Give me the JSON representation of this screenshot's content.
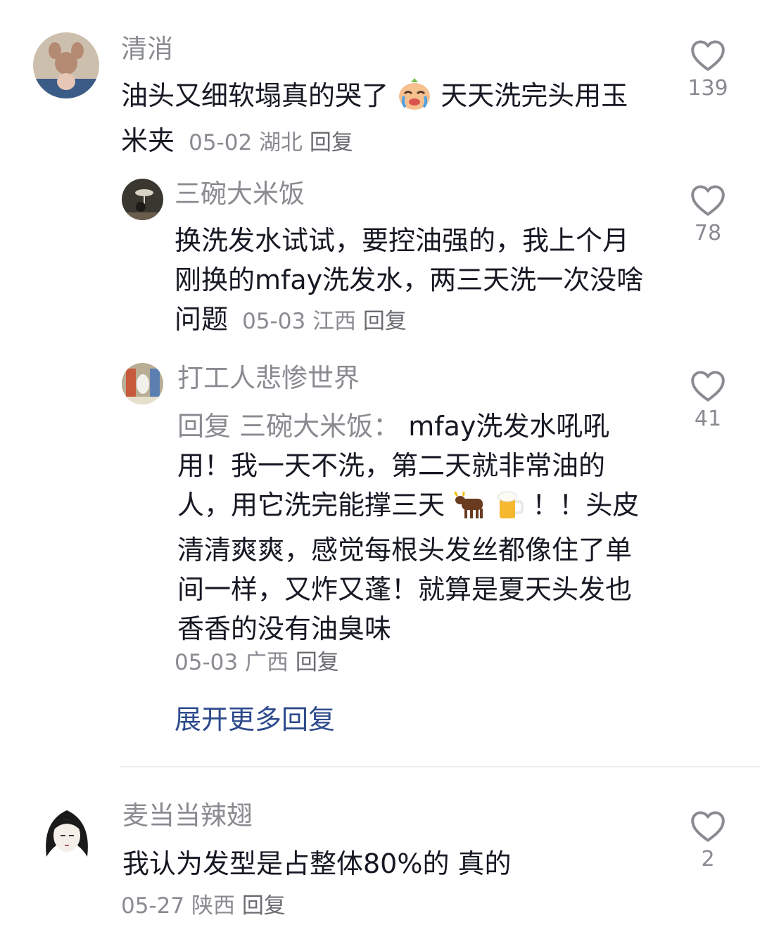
{
  "comments": [
    {
      "username": "清消",
      "text": "油头又细软塌真的哭了",
      "emoji": "crying-face-icon",
      "text_after": "天天洗完头用玉米夹",
      "date": "05-02",
      "location": "湖北",
      "reply_label": "回复",
      "likes": "139"
    },
    {
      "username": "三碗大米饭",
      "text": "换洗发水试试，要控油强的，我上个月刚换的mfay洗发水，两三天洗一次没啥问题",
      "date": "05-03",
      "location": "江西",
      "reply_label": "回复",
      "likes": "78"
    },
    {
      "username": "打工人悲惨世界",
      "reply_prefix": "回复",
      "reply_to": "三碗大米饭：",
      "text": "mfay洗发水吼吼用！我一天不洗，第二天就非常油的人，用它洗完能撑三天",
      "emojis": [
        "ox-icon",
        "beer-mug-icon"
      ],
      "text_after": "！！头皮清清爽爽，感觉每根头发丝都像住了单间一样，又炸又蓬！就算是夏天头发也香香的没有油臭味",
      "date": "05-03",
      "location": "广西",
      "reply_label": "回复",
      "likes": "41"
    },
    {
      "username": "麦当当辣翅",
      "text": "我认为发型是占整体80%的 真的",
      "date": "05-27",
      "location": "陕西",
      "reply_label": "回复",
      "likes": "2"
    }
  ],
  "expand_replies": "展开更多回复",
  "colors": {
    "muted": "#8a8b91",
    "link": "#2d4b8c",
    "text": "#161823"
  }
}
